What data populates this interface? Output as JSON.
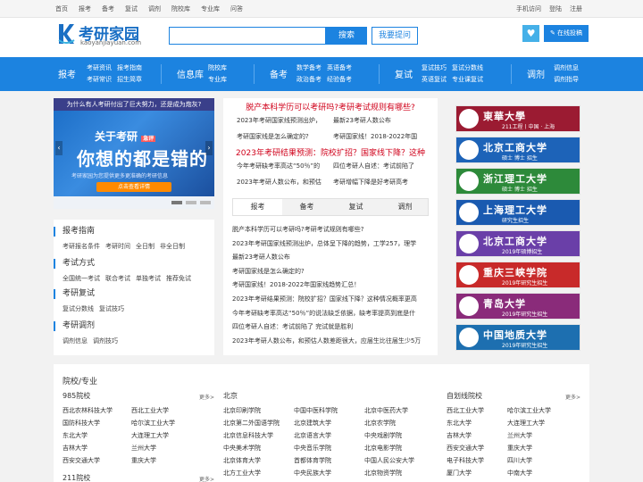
{
  "topbar": {
    "left": [
      "首页",
      "报考",
      "备考",
      "复试",
      "调剂",
      "院校库",
      "专业库",
      "问答"
    ],
    "right": [
      "手机访问",
      "登陆",
      "注册"
    ]
  },
  "header": {
    "logo_text": "考研家园",
    "logo_url": "kaoyanjiayuan.com",
    "search_placeholder": "",
    "search_label": "搜索",
    "ask_label": "我要提问",
    "post_label": "在线投稿",
    "heart_icon": "heart-icon"
  },
  "nav": [
    {
      "cat": "报考",
      "links": [
        [
          "考研资讯",
          "报考指南"
        ],
        [
          "考研常识",
          "招生简章"
        ]
      ]
    },
    {
      "cat": "信息库",
      "links": [
        [
          "院校库"
        ],
        [
          "专业库"
        ]
      ]
    },
    {
      "cat": "备考",
      "links": [
        [
          "数学备考",
          "英语备考"
        ],
        [
          "政治备考",
          "经验备考"
        ]
      ]
    },
    {
      "cat": "复试",
      "links": [
        [
          "复试技巧",
          "复试分数线"
        ],
        [
          "英语复试",
          "专业课复试"
        ]
      ]
    },
    {
      "cat": "调剂",
      "links": [
        [
          "调剂信息"
        ],
        [
          "调剂指导"
        ]
      ]
    }
  ],
  "banner": {
    "top_text": "为什么有人考研付出了巨大努力，还是成为炮灰?",
    "title": "关于考研",
    "tag": "急评",
    "headline": "你想的都是错的",
    "sub": "考研家园为您提供更多更准确的考研信息",
    "button": "点击查看详情"
  },
  "side": [
    {
      "title": "报考指南",
      "items": [
        "考研报名条件",
        "考研时间",
        "全日制",
        "非全日制"
      ]
    },
    {
      "title": "考试方式",
      "items": [
        "全国统一考试",
        "联合考试",
        "单独考试",
        "推荐免试"
      ]
    },
    {
      "title": "考研复试",
      "items": [
        "复试分数线",
        "复试技巧"
      ]
    },
    {
      "title": "考研调剂",
      "items": [
        "调剂信息",
        "调剂技巧"
      ]
    }
  ],
  "news": {
    "headline1": "脱产本科学历可以考研吗?考研考试规则有哪些?",
    "pairs1": [
      [
        "2023年考研国家线预测出炉，",
        "最新23考研人数公布"
      ],
      [
        "考研国家线是怎么确定的?",
        "考研国家线！2018-2022年国"
      ]
    ],
    "headline2": "2023年考研结果预测：院校扩招？国家线下降？这种",
    "pairs2": [
      [
        "今年考研缺考率高达“50％”的",
        "四位考研人自述：考试前陷了"
      ],
      [
        "2023年考研人数公布，和预估",
        "考研增幅下降是好考研高考"
      ]
    ],
    "tabs": [
      "报考",
      "备考",
      "复试",
      "调剂"
    ],
    "list": [
      "脱产本科学历可以考研吗?考研考试规则有哪些?",
      "2023年考研国家线预测出炉，总体呈下降的趋势，工学257，理学",
      "最新23考研人数公布",
      "考研国家线是怎么确定的?",
      "考研国家线！2018-2022年国家线趋势汇总！",
      "2023年考研结果预测：院校扩招？国家线下降？这种情况概率更高",
      "今年考研缺考率高达“50％”的说法缺乏依据，缺考率提高到底是什",
      "四位考研人自述：考试前陷了 完试就是胜利",
      "2023年考研人数公布，和预估人数差距很大，应届生比往届生少5万"
    ]
  },
  "schools": [
    {
      "name": "東華大學",
      "sub": "211工程丨中国 · 上海",
      "color": "#9b1b32"
    },
    {
      "name": "北京工商大学",
      "sub": "硕士 博士 招生",
      "color": "#1d63b8"
    },
    {
      "name": "浙江理工大学",
      "sub": "硕士 博士 招生",
      "color": "#2d8a3a"
    },
    {
      "name": "上海理工大学",
      "sub": "研究生招生",
      "color": "#1a5ab0"
    },
    {
      "name": "北京工商大学",
      "sub": "2019年硕博招生",
      "color": "#6a3fa8"
    },
    {
      "name": "重庆三峡学院",
      "sub": "2019年研究生招生",
      "color": "#c82a2a"
    },
    {
      "name": "青岛大学",
      "sub": "2019年研究生招生",
      "color": "#8a2b7a"
    },
    {
      "name": "中国地质大学",
      "sub": "2019年研究生招生",
      "color": "#1d6fb0"
    }
  ],
  "bottom": {
    "title": "院校/专业",
    "more": "更多>",
    "col1_title": "985院校",
    "col1": [
      [
        "西北农林科技大学",
        "西北工业大学"
      ],
      [
        "国防科技大学",
        "哈尔滨工业大学"
      ],
      [
        "东北大学",
        "大连理工大学"
      ],
      [
        "吉林大学",
        "兰州大学"
      ],
      [
        "西安交通大学",
        "重庆大学"
      ]
    ],
    "col1_next": "211院校",
    "col2_title": "北京",
    "col2": [
      [
        "北京印刷学院",
        "中国中医科学院",
        "北京中医药大学"
      ],
      [
        "北京第二外国语学院",
        "北京建筑大学",
        "北京农学院"
      ],
      [
        "北京信息科技大学",
        "北京语言大学",
        "中央戏剧学院"
      ],
      [
        "中央美术学院",
        "中央音乐学院",
        "北京电影学院"
      ],
      [
        "北京体育大学",
        "首都体育学院",
        "中国人民公安大学"
      ],
      [
        "北方工业大学",
        "中央民族大学",
        "北京物资学院"
      ]
    ],
    "col3_title": "自划线院校",
    "col3": [
      [
        "西北工业大学",
        "哈尔滨工业大学"
      ],
      [
        "东北大学",
        "大连理工大学"
      ],
      [
        "吉林大学",
        "兰州大学"
      ],
      [
        "西安交通大学",
        "重庆大学"
      ],
      [
        "电子科技大学",
        "四川大学"
      ],
      [
        "厦门大学",
        "中南大学"
      ]
    ]
  }
}
